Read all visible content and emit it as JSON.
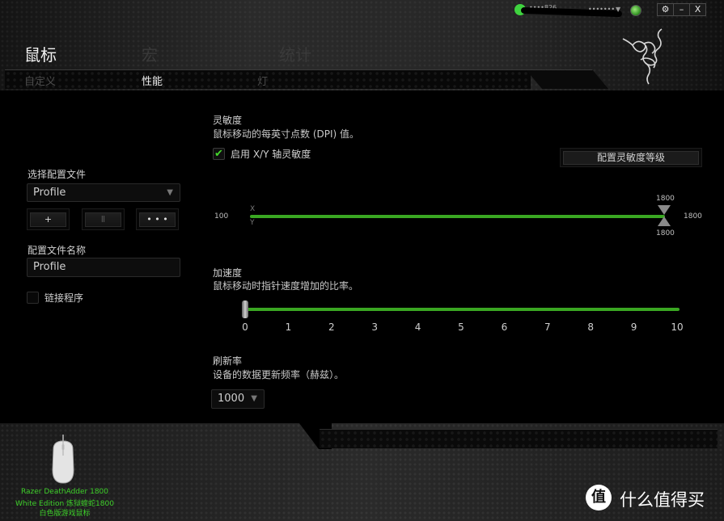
{
  "titlebar": {
    "user_name": "••••826",
    "status_text": "•••••••",
    "settings_icon": "gear-icon",
    "minimize_label": "–",
    "close_label": "X"
  },
  "header": {
    "top_tabs": [
      {
        "label": "鼠标",
        "active": true
      },
      {
        "label": "宏",
        "active": false
      },
      {
        "label": "统计",
        "active": false
      }
    ],
    "sub_tabs": [
      {
        "label": "自定义",
        "active": false
      },
      {
        "label": "性能",
        "active": true
      },
      {
        "label": "灯",
        "active": false
      }
    ],
    "logo": "razer-logo"
  },
  "sidebar": {
    "select_profile_label": "选择配置文件",
    "profile_selected": "Profile",
    "add_label": "+",
    "delete_label": "Ⅱ",
    "more_label": "• • •",
    "profile_name_label": "配置文件名称",
    "profile_name_value": "Profile",
    "link_program_label": "链接程序",
    "link_program_checked": false
  },
  "sensitivity": {
    "title": "灵敏度",
    "description": "鼠标移动的每英寸点数 (DPI) 值。",
    "xy_checkbox_label": "启用 X/Y 轴灵敏度",
    "xy_enabled": true,
    "levels_button": "配置灵敏度等级",
    "min": "100",
    "max": "1800",
    "x_axis_label": "X",
    "y_axis_label": "Y",
    "x_value": "1800",
    "y_value": "1800",
    "value_fraction": 1.0
  },
  "acceleration": {
    "title": "加速度",
    "description": "鼠标移动时指针速度增加的比率。",
    "value": 0,
    "ticks": [
      "0",
      "1",
      "2",
      "3",
      "4",
      "5",
      "6",
      "7",
      "8",
      "9",
      "10"
    ]
  },
  "polling": {
    "title": "刷新率",
    "description": "设备的数据更新频率（赫兹）。",
    "selected": "1000"
  },
  "device": {
    "name_lines": [
      "Razer DeathAdder 1800",
      "White Edition 炼狱蝰蛇1800",
      "白色版游戏鼠标"
    ]
  },
  "watermark": {
    "icon_char": "值",
    "text": "什么值得买"
  },
  "colors": {
    "accent": "#44d62c",
    "track": "#3aa722"
  }
}
